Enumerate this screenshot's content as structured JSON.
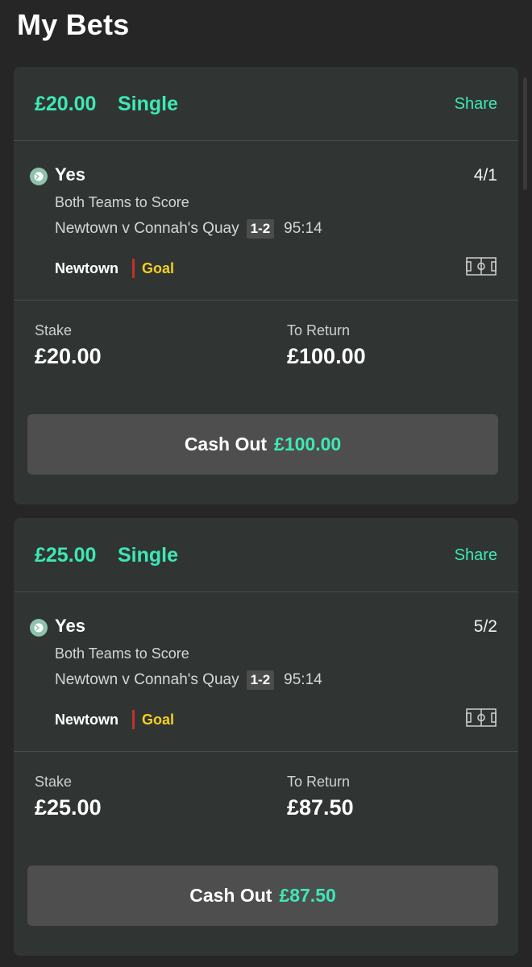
{
  "page": {
    "title": "My Bets"
  },
  "colors": {
    "accent": "#3ee8b5",
    "goal": "#f5d020",
    "incident_bar": "#c4302b",
    "card_bg": "#303533",
    "page_bg": "#262626"
  },
  "bets": [
    {
      "amount": "£20.00",
      "type": "Single",
      "share_label": "Share",
      "selection": "Yes",
      "odds": "4/1",
      "market": "Both Teams to Score",
      "event": "Newtown v Connah's Quay",
      "score": "1-2",
      "clock": "95:14",
      "incident_team": "Newtown",
      "incident_type": "Goal",
      "stake_label": "Stake",
      "stake": "£20.00",
      "return_label": "To Return",
      "to_return": "£100.00",
      "cashout_label": "Cash Out",
      "cashout_value": "£100.00",
      "status_icon": "in-play-ball-icon",
      "pitch_icon": "pitch-icon"
    },
    {
      "amount": "£25.00",
      "type": "Single",
      "share_label": "Share",
      "selection": "Yes",
      "odds": "5/2",
      "market": "Both Teams to Score",
      "event": "Newtown v Connah's Quay",
      "score": "1-2",
      "clock": "95:14",
      "incident_team": "Newtown",
      "incident_type": "Goal",
      "stake_label": "Stake",
      "stake": "£25.00",
      "return_label": "To Return",
      "to_return": "£87.50",
      "cashout_label": "Cash Out",
      "cashout_value": "£87.50",
      "status_icon": "in-play-ball-icon",
      "pitch_icon": "pitch-icon"
    }
  ]
}
